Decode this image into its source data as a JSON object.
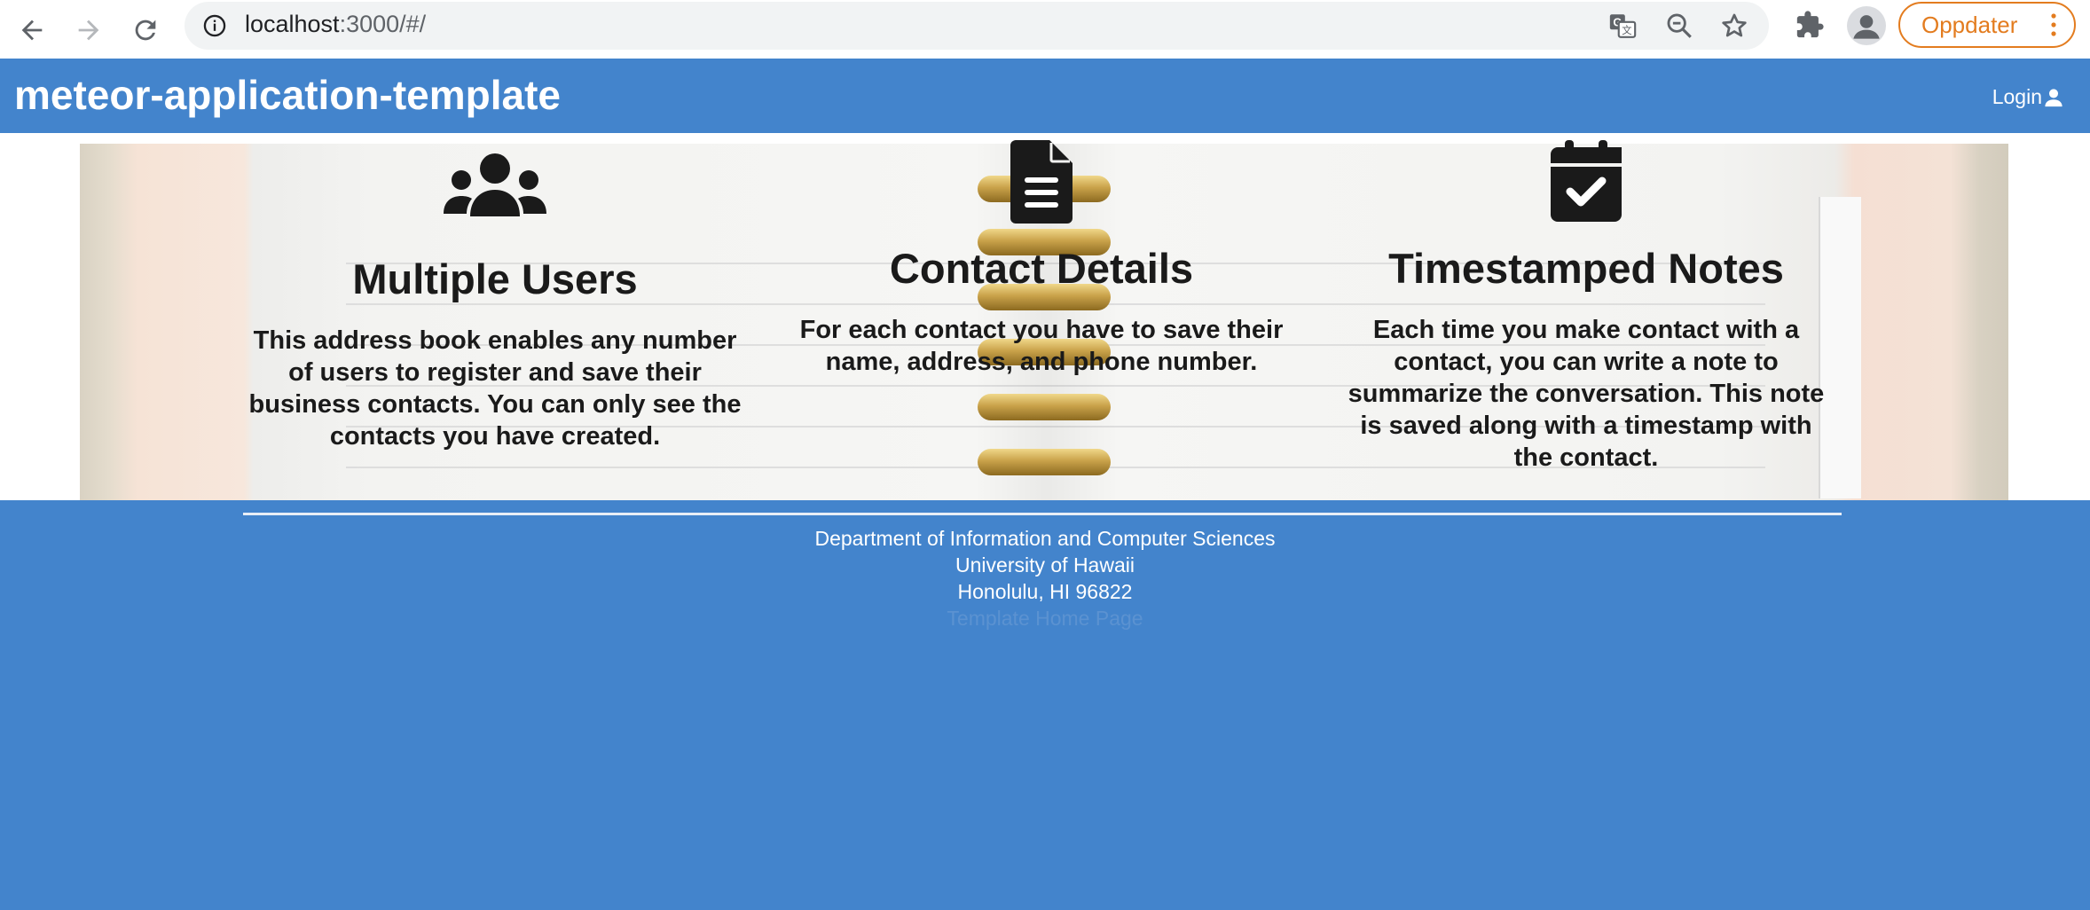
{
  "browser": {
    "url_host": "localhost",
    "url_rest": ":3000/#/",
    "update_button_label": "Oppdater",
    "icons": [
      "back-icon",
      "forward-icon",
      "reload-icon",
      "info-icon",
      "translate-icon",
      "zoom-out-icon",
      "bookmark-star-icon",
      "extensions-icon",
      "profile-icon",
      "menu-dots-icon"
    ]
  },
  "navbar": {
    "brand": "meteor-application-template",
    "login_label": "Login"
  },
  "features": [
    {
      "icon": "users-icon",
      "title": "Multiple Users",
      "text": "This address book enables any number of users to register and save their business contacts. You can only see the contacts you have created."
    },
    {
      "icon": "file-text-icon",
      "title": "Contact Details",
      "text": "For each contact you have to save their name, address, and phone number."
    },
    {
      "icon": "calendar-check-icon",
      "title": "Timestamped Notes",
      "text": "Each time you make contact with a contact, you can write a note to summarize the conversation. This note is saved along with a timestamp with the contact."
    }
  ],
  "footer": {
    "line1": "Department of Information and Computer Sciences",
    "line2": "University of Hawaii",
    "line3": "Honolulu, HI 96822",
    "line4": "Template Home Page"
  },
  "colors": {
    "brand_blue": "#4384cc",
    "update_orange": "#e37c1f"
  }
}
